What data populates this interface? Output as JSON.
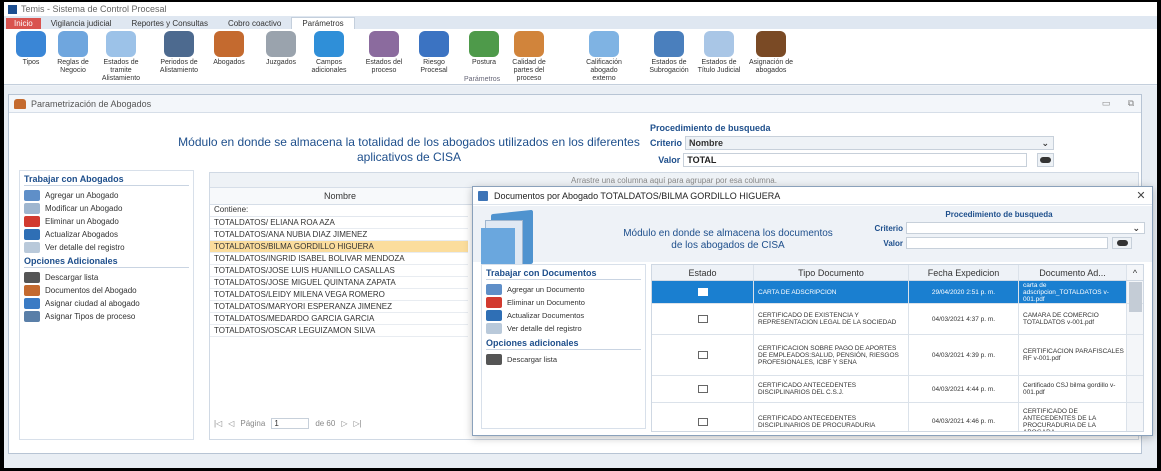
{
  "app": {
    "title": "Temis - Sistema de Control Procesal",
    "tabs": [
      {
        "label": "Inicio"
      },
      {
        "label": "Vigilancia judicial"
      },
      {
        "label": "Reportes y Consultas"
      },
      {
        "label": "Cobro coactivo"
      },
      {
        "label": "Parámetros"
      }
    ],
    "ribbon_group_label": "Parámetros",
    "ribbon_items": [
      {
        "label": "Tipos",
        "icon": "tipos-icon",
        "color": "#3a86d6"
      },
      {
        "label": "Reglas de Negocio",
        "icon": "handshake-icon",
        "color": "#6fa6de"
      },
      {
        "label": "Estados de tramite Alistamiento",
        "icon": "document-state-icon",
        "color": "#9cc2e8"
      },
      {
        "label": "Periodos de Alistamiento",
        "icon": "calendar-icon",
        "color": "#4d6a8f"
      },
      {
        "label": "Abogados",
        "icon": "lawyer-icon",
        "color": "#c46a2f"
      },
      {
        "label": "Juzgados",
        "icon": "court-icon",
        "color": "#9aa3ad"
      },
      {
        "label": "Campos adicionales",
        "icon": "tools-icon",
        "color": "#2f8fd8"
      },
      {
        "label": "Estados del proceso",
        "icon": "books-icon",
        "color": "#8b6b9e"
      },
      {
        "label": "Riesgo Procesal",
        "icon": "risk-icon",
        "color": "#3b73c2"
      },
      {
        "label": "Postura",
        "icon": "posture-icon",
        "color": "#4e9a4a"
      },
      {
        "label": "Calidad de partes del proceso",
        "icon": "parties-icon",
        "color": "#d1843b"
      },
      {
        "label": "Calificación abogado externo",
        "icon": "rating-icon",
        "color": "#7fb3e3"
      },
      {
        "label": "Estados de Subrogación",
        "icon": "subrogation-icon",
        "color": "#4a7fbd"
      },
      {
        "label": "Estados de Título Judicial",
        "icon": "title-icon",
        "color": "#a9c6e6"
      },
      {
        "label": "Asignación de abogados",
        "icon": "gavel-icon",
        "color": "#7a4a25"
      }
    ]
  },
  "child": {
    "title": "Parametrización de Abogados",
    "module_text": "Módulo en donde se almacena la totalidad de los abogados utilizados en los diferentes aplicativos de CISA",
    "search": {
      "title": "Procedimiento de busqueda",
      "criterio_label": "Criterio",
      "criterio_value": "Nombre",
      "valor_label": "Valor",
      "valor_value": "TOTAL"
    },
    "side": {
      "section1": "Trabajar con Abogados",
      "items1": [
        {
          "label": "Agregar un Abogado",
          "icon": "add-lawyer-icon",
          "color": "#5f8fc8"
        },
        {
          "label": "Modificar un Abogado",
          "icon": "edit-lawyer-icon",
          "color": "#9fb6cf"
        },
        {
          "label": "Eliminar un Abogado",
          "icon": "delete-icon",
          "color": "#d23a2f"
        },
        {
          "label": "Actualizar Abogados",
          "icon": "refresh-icon",
          "color": "#2f6fb5"
        },
        {
          "label": "Ver detalle del registro",
          "icon": "detail-icon",
          "color": "#b9c9da"
        }
      ],
      "section2": "Opciones Adicionales",
      "items2": [
        {
          "label": "Descargar lista",
          "icon": "download-list-icon",
          "color": "#555555"
        },
        {
          "label": "Documentos del Abogado",
          "icon": "lawyer-documents-icon",
          "color": "#c46a2f"
        },
        {
          "label": "Asignar ciudad al abogado",
          "icon": "assign-city-icon",
          "color": "#3b7bc4"
        },
        {
          "label": "Asignar Tipos de proceso",
          "icon": "assign-types-icon",
          "color": "#5a7fa8"
        }
      ]
    },
    "grid": {
      "drag_hint": "Arrastre una columna aquí para agrupar por esa columna.",
      "column": "Nombre",
      "filter_text": "Contiene:",
      "rows": [
        "TOTALDATOS/ ELIANA ROA AZA",
        "TOTALDATOS/ANA NUBIA DIAZ JIMENEZ",
        "TOTALDATOS/BILMA GORDILLO HIGUERA",
        "TOTALDATOS/INGRID ISABEL BOLIVAR MENDOZA",
        "TOTALDATOS/JOSE LUIS HUANILLO CASALLAS",
        "TOTALDATOS/JOSE MIGUEL QUINTANA ZAPATA",
        "TOTALDATOS/LEIDY MILENA VEGA ROMERO",
        "TOTALDATOS/MARYORI ESPERANZA JIMENEZ",
        "TOTALDATOS/MEDARDO GARCIA GARCIA",
        "TOTALDATOS/OSCAR LEGUIZAMON SILVA"
      ],
      "selected_index": 2,
      "pager": {
        "page_label": "Página",
        "page_value": "1",
        "of_label": "de 60"
      }
    }
  },
  "dialog": {
    "title": "Documentos por Abogado TOTALDATOS/BILMA GORDILLO HIGUERA",
    "module_text": "Módulo en donde se almacena los documentos de los abogados de CISA",
    "search": {
      "title": "Procedimiento de busqueda",
      "criterio_label": "Criterio",
      "valor_label": "Valor"
    },
    "side": {
      "section1": "Trabajar con Documentos",
      "items1": [
        {
          "label": "Agregar un Documento",
          "icon": "add-document-icon",
          "color": "#5f8fc8"
        },
        {
          "label": "Eliminar un Documento",
          "icon": "delete-document-icon",
          "color": "#d23a2f"
        },
        {
          "label": "Actualizar Documentos",
          "icon": "refresh-documents-icon",
          "color": "#2f6fb5"
        },
        {
          "label": "Ver detalle del registro",
          "icon": "detail-icon",
          "color": "#b9c9da"
        }
      ],
      "section2": "Opciones adicionales",
      "items2": [
        {
          "label": "Descargar lista",
          "icon": "download-list-icon",
          "color": "#555555"
        }
      ]
    },
    "grid": {
      "columns": [
        "Estado",
        "Tipo Documento",
        "Fecha Expedicion",
        "Documento Ad..."
      ],
      "rows": [
        {
          "tipo": "CARTA DE ADSCRIPCION",
          "fecha": "29/04/2020 2:51 p. m.",
          "doc": "carta de adscripcion_TOTALDATOS v-001.pdf",
          "selected": true
        },
        {
          "tipo": "CERTIFICADO DE EXISTENCIA Y REPRESENTACION LEGAL DE LA SOCIEDAD",
          "fecha": "04/03/2021 4:37 p. m.",
          "doc": "CAMARA DE COMERCIO TOTALDATOS v-001.pdf",
          "selected": false
        },
        {
          "tipo": "CERTIFICACION SOBRE PAGO DE APORTES DE EMPLEADOS:SALUD, PENSIÓN, RIESGOS PROFESIONALES, ICBF Y SENA",
          "fecha": "04/03/2021 4:39 p. m.",
          "doc": "CERTIFICACION PARAFISCALES RF v-001.pdf",
          "selected": false
        },
        {
          "tipo": "CERTIFICADO ANTECEDENTES DISCIPLINARIOS DEL C.S.J.",
          "fecha": "04/03/2021 4:44 p. m.",
          "doc": "Certificado CSJ bilma gordillo v-001.pdf",
          "selected": false
        },
        {
          "tipo": "CERTIFICADO ANTECEDENTES DISCIPLINARIOS DE PROCURADURIA",
          "fecha": "04/03/2021 4:46 p. m.",
          "doc": "CERTIFICADO DE ANTECEDENTES DE LA PROCURADURIA DE LA ABOGADA",
          "selected": false
        }
      ]
    }
  }
}
